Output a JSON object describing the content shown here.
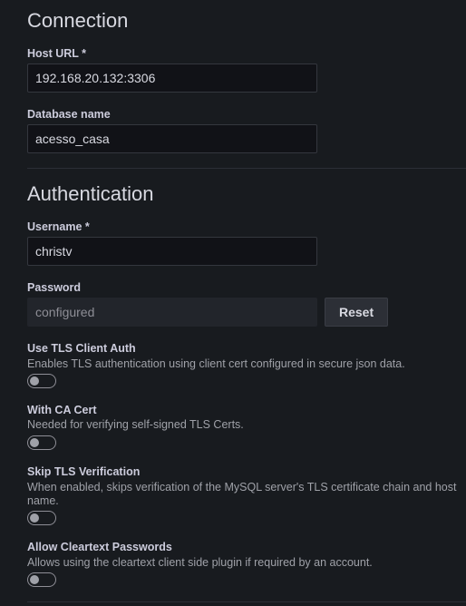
{
  "connection": {
    "title": "Connection",
    "host_url_label": "Host URL *",
    "host_url_value": "192.168.20.132:3306",
    "database_label": "Database name",
    "database_value": "acesso_casa"
  },
  "authentication": {
    "title": "Authentication",
    "username_label": "Username *",
    "username_value": "christv",
    "password_label": "Password",
    "password_value": "configured",
    "reset_label": "Reset"
  },
  "options": [
    {
      "label": "Use TLS Client Auth",
      "description": "Enables TLS authentication using client cert configured in secure json data.",
      "enabled": false
    },
    {
      "label": "With CA Cert",
      "description": "Needed for verifying self-signed TLS Certs.",
      "enabled": false
    },
    {
      "label": "Skip TLS Verification",
      "description": "When enabled, skips verification of the MySQL server's TLS certificate chain and host name.",
      "enabled": false
    },
    {
      "label": "Allow Cleartext Passwords",
      "description": "Allows using the cleartext client side plugin if required by an account.",
      "enabled": false
    }
  ],
  "colors": {
    "background": "#181b1f",
    "input_background": "#111217",
    "text": "#ccccdc",
    "muted_text": "#9fa1a8"
  }
}
